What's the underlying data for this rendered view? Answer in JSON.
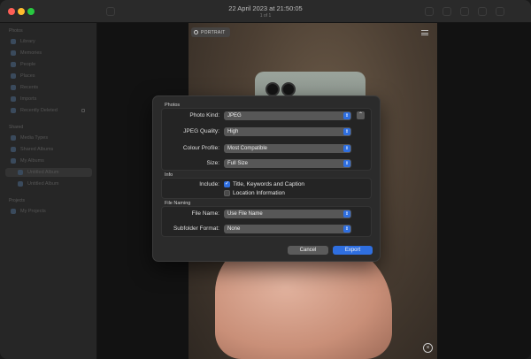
{
  "window": {
    "title": "22 April 2023 at 21:50:05",
    "subtitle": "1 of 1"
  },
  "sidebar": {
    "sections": [
      {
        "label": "Photos"
      },
      {
        "label": "Shared"
      },
      {
        "label": "Projects"
      }
    ],
    "items": [
      {
        "label": "Library"
      },
      {
        "label": "Memories"
      },
      {
        "label": "People"
      },
      {
        "label": "Places"
      },
      {
        "label": "Recents"
      },
      {
        "label": "Imports"
      },
      {
        "label": "Recently Deleted"
      },
      {
        "label": "Media Types"
      },
      {
        "label": "Shared Albums"
      },
      {
        "label": "My Albums"
      },
      {
        "label": "Untitled Album"
      },
      {
        "label": "Untitled Album"
      },
      {
        "label": "My Projects"
      }
    ]
  },
  "viewer": {
    "badge": "PORTRAIT"
  },
  "dialog": {
    "photos_group_title": "Photos",
    "photo_kind_label": "Photo Kind:",
    "photo_kind_value": "JPEG",
    "jpeg_quality_label": "JPEG Quality:",
    "jpeg_quality_value": "High",
    "colour_profile_label": "Colour Profile:",
    "colour_profile_value": "Most Compatible",
    "size_label": "Size:",
    "size_value": "Full Size",
    "info_group_title": "Info",
    "include_label": "Include:",
    "include_title_keywords": "Title, Keywords and Caption",
    "include_title_keywords_checked": true,
    "include_location": "Location Information",
    "include_location_checked": false,
    "file_naming_group_title": "File Naming",
    "file_name_label": "File Name:",
    "file_name_value": "Use File Name",
    "subfolder_format_label": "Subfolder Format:",
    "subfolder_format_value": "None",
    "cancel_label": "Cancel",
    "export_label": "Export",
    "accent_color": "#2f6fe0"
  }
}
